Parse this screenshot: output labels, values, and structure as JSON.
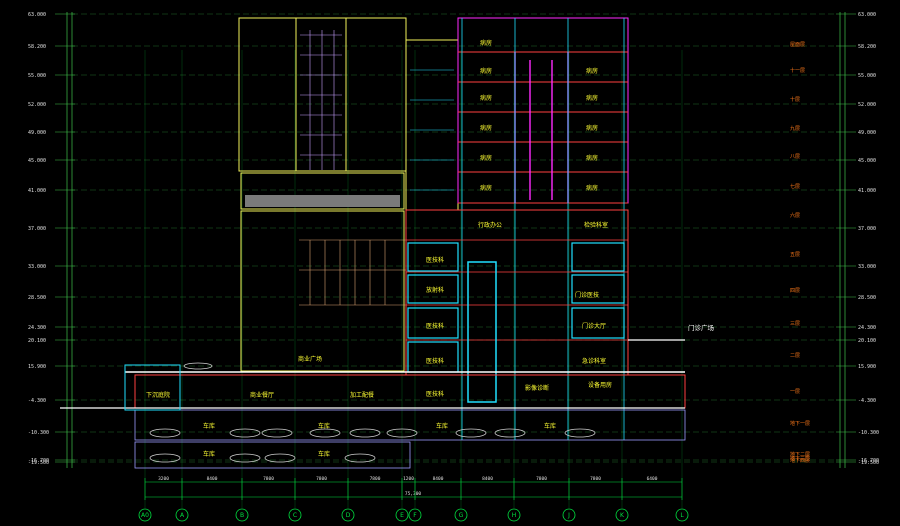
{
  "drawing": {
    "title": "",
    "colors": {
      "background": "#000000",
      "level_line": "#3ec24a",
      "grid_line": "#00e040",
      "wall_yellow": "#f2f25a",
      "wall_magenta": "#ff2aff",
      "wall_red": "#ff4040",
      "wall_cyan": "#20e0ff",
      "ground": "#ffffff",
      "room_label": "#ffff33",
      "note_label": "#ff7a1a",
      "text": "#e0e0e0"
    },
    "levels_left": [
      "63.000",
      "58.200",
      "55.000",
      "52.000",
      "49.000",
      "45.000",
      "41.000",
      "37.000",
      "33.000",
      "28.500",
      "24.300",
      "20.100",
      "15.900",
      "-4.300",
      "-10.300",
      "-16.700",
      "-19.500"
    ],
    "levels_right": [
      "63.000",
      "58.200",
      "55.000",
      "52.000",
      "49.000",
      "45.000",
      "41.000",
      "37.000",
      "33.000",
      "28.500",
      "24.300",
      "20.100",
      "15.900",
      "-4.300",
      "-10.300",
      "-16.700",
      "-19.500"
    ],
    "floor_notes": [
      "屋面层",
      "十一层",
      "十层",
      "九层",
      "八层",
      "七层",
      "六层",
      "五层",
      "四层",
      "三层",
      "二层",
      "一层",
      "地下一层",
      "地下二层",
      "地下三层",
      "地下四层"
    ],
    "rooms_left": [
      "下沉庭院",
      "车库",
      "车库",
      "商业餐厅",
      "商业广场",
      "加工配餐",
      "车库",
      "车库"
    ],
    "rooms_right": [
      "病房",
      "病房",
      "病房",
      "病房",
      "病房",
      "病房",
      "病房",
      "病房",
      "病房",
      "病房",
      "行政办公",
      "检验科室",
      "医技科",
      "放射科",
      "医技科",
      "医技科",
      "医技科",
      "门诊大厅",
      "急诊科室",
      "设备用房",
      "车库",
      "车库",
      "车库",
      "影像诊断",
      "门诊医技",
      "病房"
    ],
    "plaza_label": "门诊广场",
    "grid_axes": [
      "A0",
      "A",
      "B",
      "C",
      "D",
      "E",
      "F",
      "G",
      "H",
      "J",
      "K",
      "L"
    ],
    "dimensions_bottom": [
      "3200",
      "8400",
      "7800",
      "7800",
      "7800",
      "1200",
      "8400",
      "8400",
      "7800",
      "7800",
      "6400"
    ],
    "dimension_total": "75,300"
  }
}
